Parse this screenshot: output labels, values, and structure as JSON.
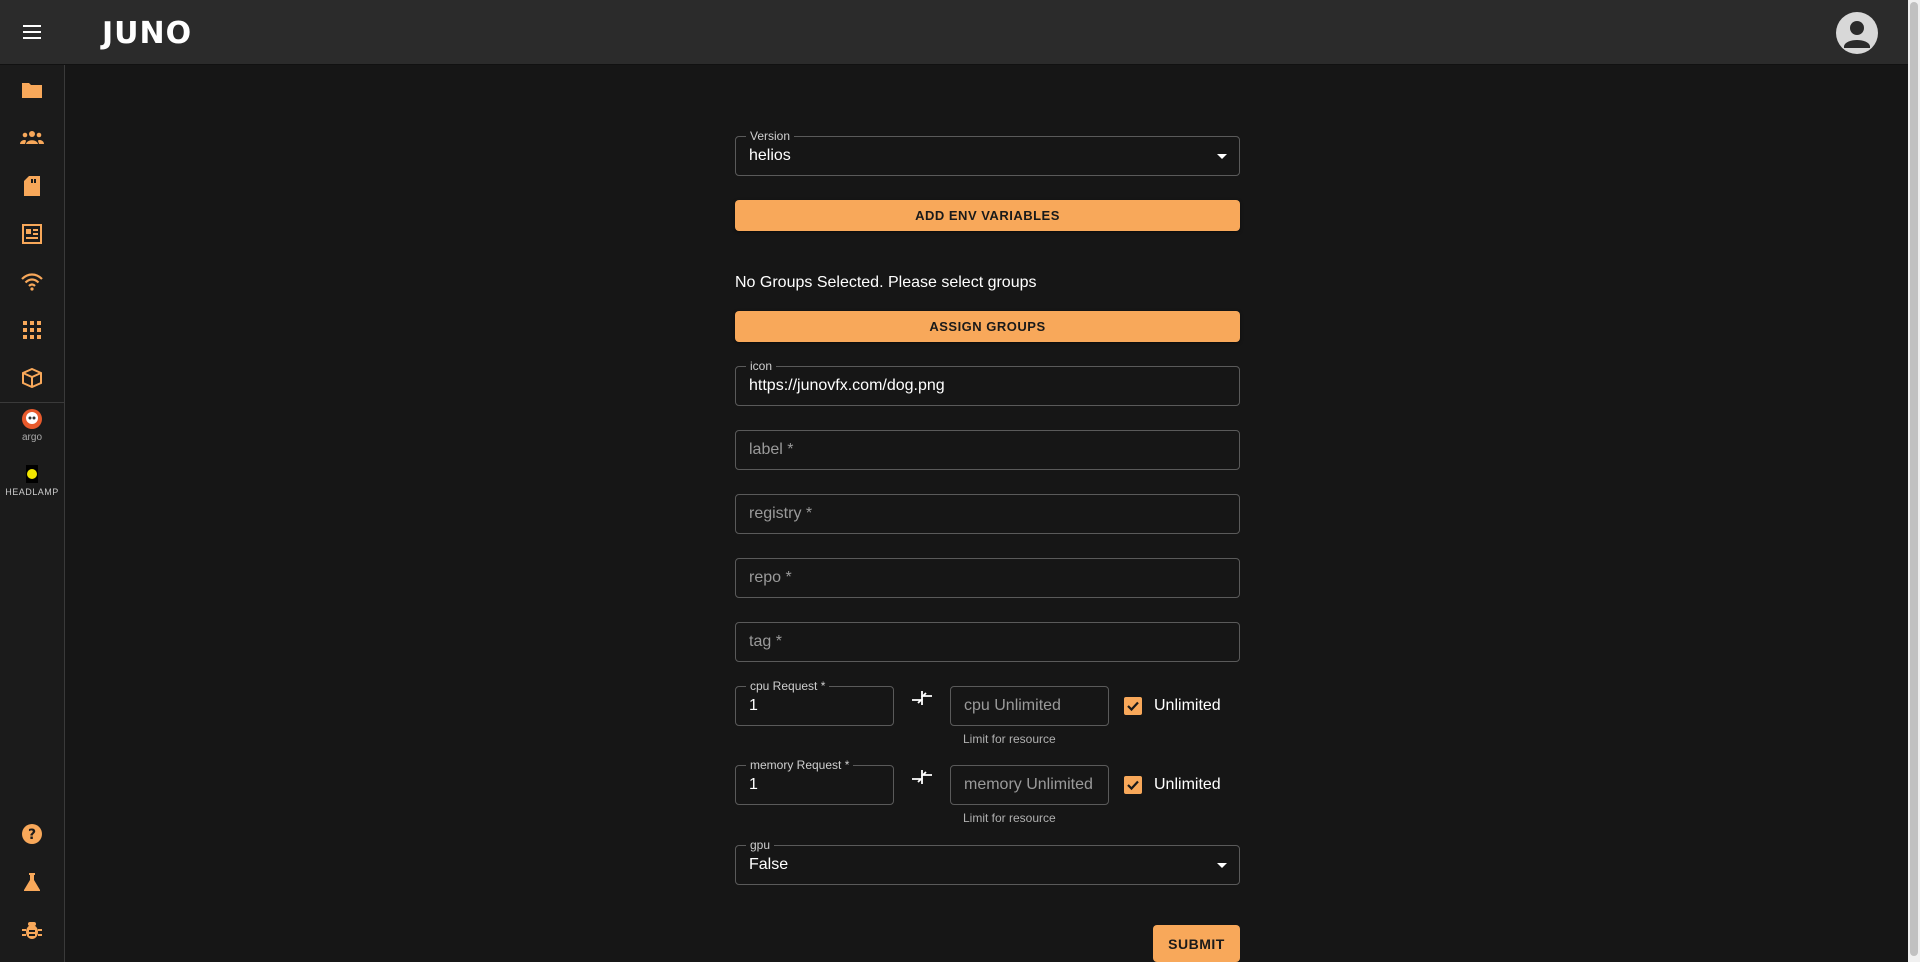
{
  "app": {
    "logo_text": "JUNO"
  },
  "sidebar": {
    "items": [
      {
        "icon": "folder-icon"
      },
      {
        "icon": "groups-icon"
      },
      {
        "icon": "sd-card-icon"
      },
      {
        "icon": "newspaper-icon"
      },
      {
        "icon": "wifi-icon"
      },
      {
        "icon": "apps-grid-icon"
      },
      {
        "icon": "package-icon"
      }
    ],
    "integrations": [
      {
        "label": "argo"
      },
      {
        "label": "HEADLAMP"
      }
    ],
    "bottom": [
      {
        "icon": "help-icon"
      },
      {
        "icon": "flask-icon"
      },
      {
        "icon": "bug-icon"
      }
    ]
  },
  "form": {
    "version": {
      "label": "Version",
      "value": "helios"
    },
    "add_env_label": "ADD ENV VARIABLES",
    "groups_notice": "No Groups Selected. Please select groups",
    "assign_groups_label": "ASSIGN GROUPS",
    "icon": {
      "label": "icon",
      "value": "https://junovfx.com/dog.png"
    },
    "label_field": {
      "placeholder": "label *"
    },
    "registry_field": {
      "placeholder": "registry *"
    },
    "repo_field": {
      "placeholder": "repo *"
    },
    "tag_field": {
      "placeholder": "tag *"
    },
    "cpu": {
      "request_label": "cpu Request *",
      "request_value": "1",
      "limit_placeholder": "cpu Unlimited",
      "helper": "Limit for resource",
      "unlimited_label": "Unlimited",
      "unlimited_checked": true
    },
    "memory": {
      "request_label": "memory Request *",
      "request_value": "1",
      "limit_placeholder": "memory Unlimited",
      "helper": "Limit for resource",
      "unlimited_label": "Unlimited",
      "unlimited_checked": true
    },
    "gpu": {
      "label": "gpu",
      "value": "False"
    },
    "submit_label": "SUBMIT"
  },
  "colors": {
    "accent": "#f8a85a",
    "background": "#161616",
    "topbar": "#2b2b2b"
  }
}
